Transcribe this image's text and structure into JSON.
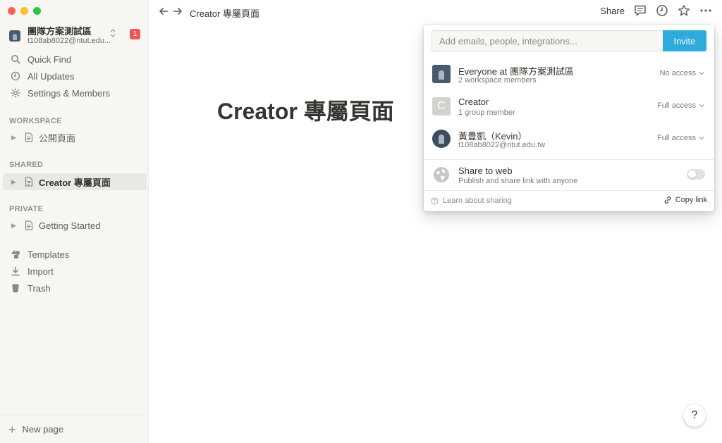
{
  "workspace": {
    "name": "團隊方案測試區",
    "email": "t108ab8022@ntut.edu...",
    "switch_glyph": "⌃⌄",
    "badge": "1"
  },
  "sidebar": {
    "menu": [
      {
        "label": "Quick Find",
        "icon": "search-icon"
      },
      {
        "label": "All Updates",
        "icon": "clock-icon"
      },
      {
        "label": "Settings & Members",
        "icon": "gear-icon"
      }
    ],
    "sections": {
      "workspace": "WORKSPACE",
      "shared": "SHARED",
      "private": "PRIVATE"
    },
    "pages": {
      "workspace_page": "公開頁面",
      "shared_page": "Creator 專屬頁面",
      "private_page": "Getting Started"
    },
    "bottom_menu": [
      {
        "label": "Templates",
        "icon": "templates-icon"
      },
      {
        "label": "Import",
        "icon": "import-icon"
      },
      {
        "label": "Trash",
        "icon": "trash-icon"
      }
    ],
    "new_page": "New page"
  },
  "topbar": {
    "breadcrumb": "Creator 專屬頁面",
    "share_label": "Share"
  },
  "page": {
    "title": "Creator 專屬頁面"
  },
  "share_popup": {
    "invite_placeholder": "Add emails, people, integrations...",
    "invite_label": "Invite",
    "members": [
      {
        "name": "Everyone at 團隊方案測試區",
        "sub": "2 workspace members",
        "access": "No access"
      },
      {
        "name": "Creator",
        "sub": "1 group member",
        "access": "Full access",
        "initial": "C"
      },
      {
        "name": "黃豊凱（Kevin）",
        "sub": "t108ab8022@ntut.edu.tw",
        "access": "Full access"
      }
    ],
    "share_web": {
      "title": "Share to web",
      "sub": "Publish and share link with anyone",
      "enabled": false
    },
    "learn_label": "Learn about sharing",
    "copy_label": "Copy link"
  },
  "help_label": "?",
  "colors": {
    "accent": "#2eaadc",
    "badge": "#eb5757",
    "sidebar_bg": "#f7f6f3"
  }
}
